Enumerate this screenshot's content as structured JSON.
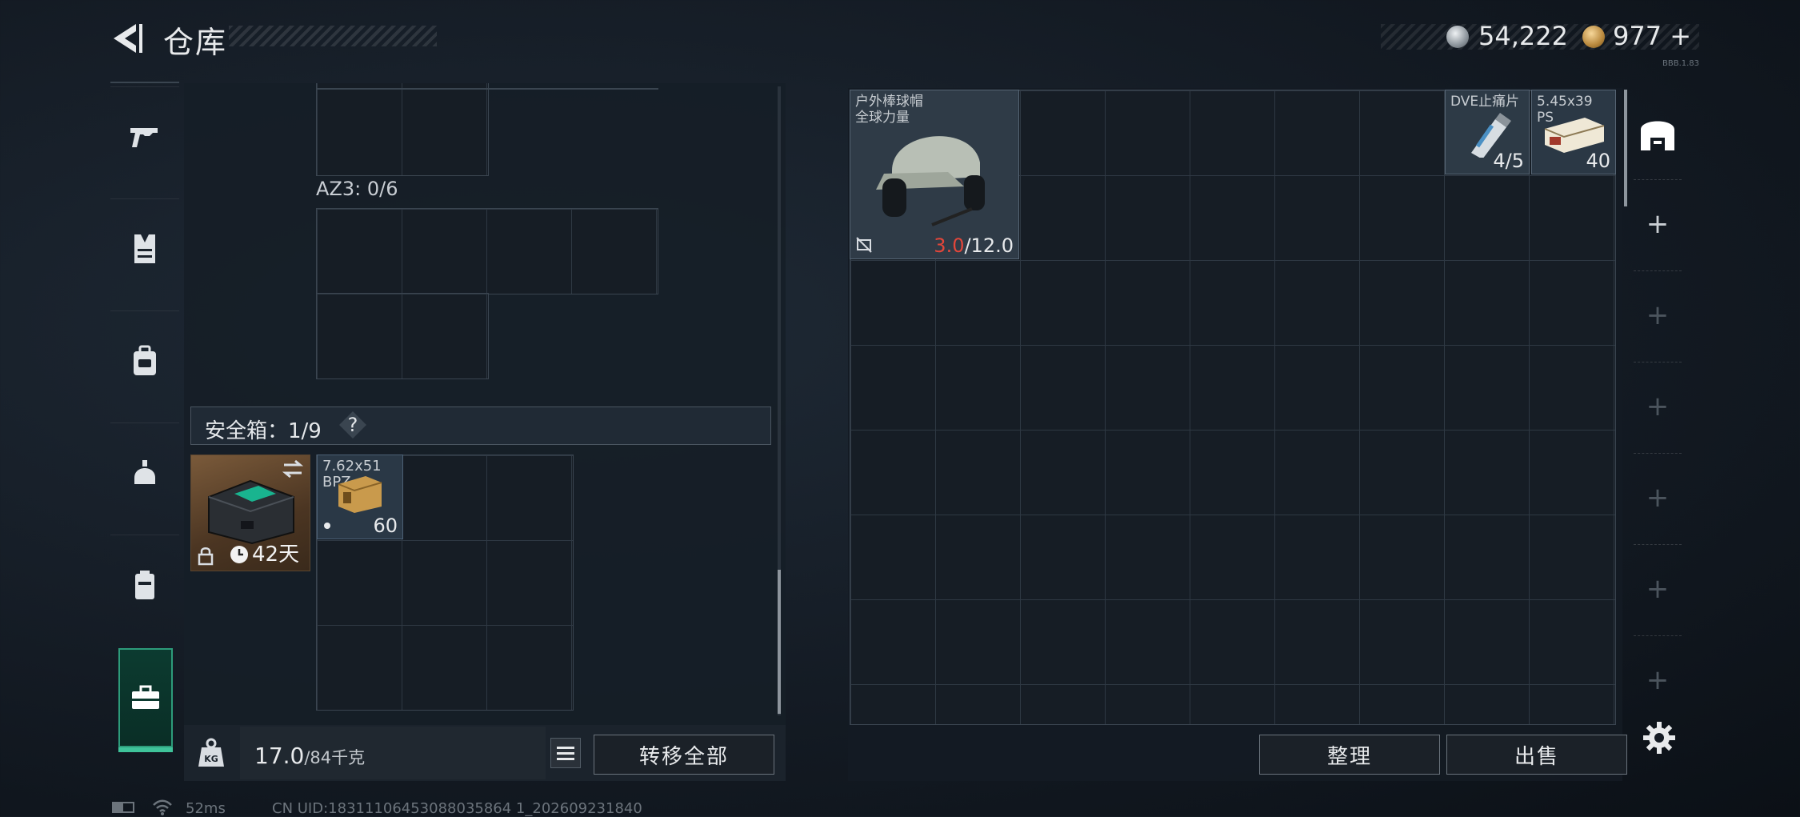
{
  "header": {
    "title": "仓库",
    "silver_amount": "54,222",
    "gold_amount": "977",
    "gold_plus": "+",
    "small_tag": "BBB.1.83"
  },
  "sidebar": {
    "items": [
      {
        "icon": "pistol-icon"
      },
      {
        "icon": "vest-icon"
      },
      {
        "icon": "backpack-icon"
      },
      {
        "icon": "helmet-icon"
      },
      {
        "icon": "rig-icon"
      },
      {
        "icon": "toolbox-icon",
        "active": true
      }
    ]
  },
  "left_panel": {
    "az3_label": "AZ3: 0/6",
    "safe_box_label": "安全箱：1/9",
    "safe_box_help": "?",
    "safe_box_item": {
      "days": "42天"
    },
    "ammo_item": {
      "name": "7.62x51\nBPZ",
      "count": "60"
    },
    "weight_value": "17.0",
    "weight_total": "/84千克",
    "weight_icon_text": "KG",
    "transfer_all_label": "转移全部"
  },
  "right_panel": {
    "helmet_item": {
      "name": "户外棒球帽\n全球力量",
      "durability_current": "3.0",
      "durability_max": "/12.0"
    },
    "dve_item": {
      "name": "DVE止痛片",
      "count": "4/5"
    },
    "ps_item": {
      "name": "5.45x39\nPS",
      "count": "40"
    },
    "sort_label": "整理",
    "sell_label": "出售"
  },
  "right_sidebar": {
    "plus_label": "+"
  },
  "status_bar": {
    "ping": "52ms",
    "uid": "CN UID:18311106453088035864 1_202609231840"
  },
  "colors": {
    "accent": "#3fc39a",
    "durability_low": "#e2463a",
    "background": "#141b24"
  }
}
